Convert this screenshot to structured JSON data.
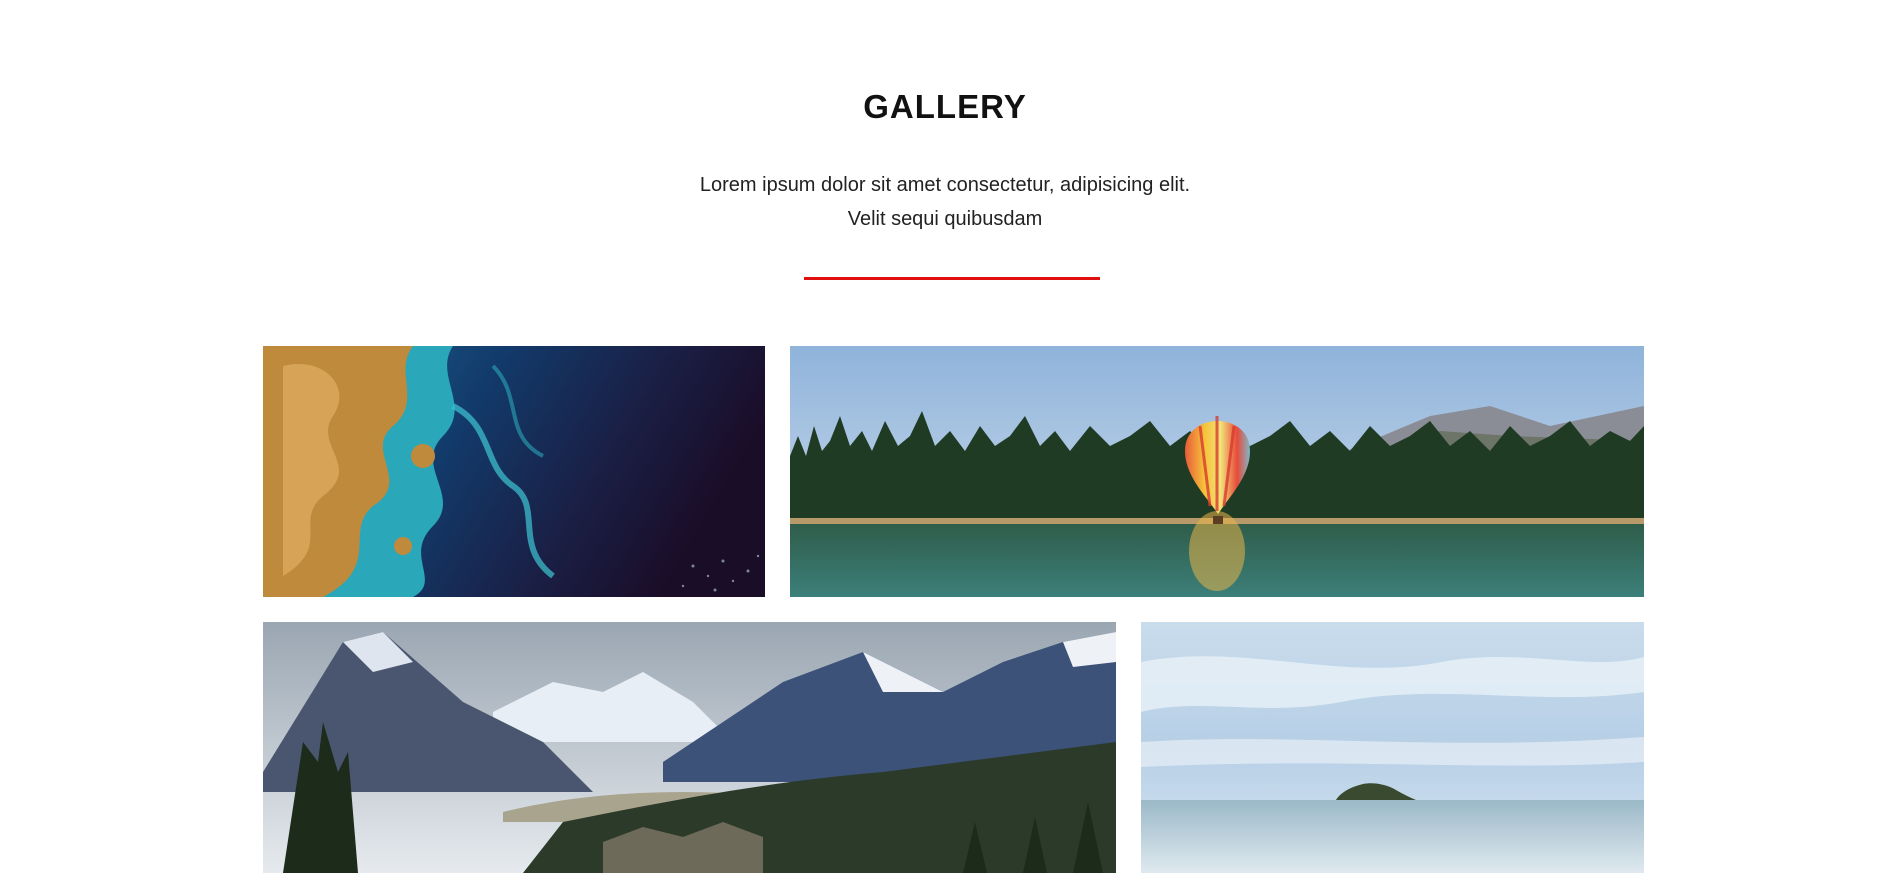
{
  "header": {
    "title": "GALLERY",
    "subtitle_line1": "Lorem ipsum dolor sit amet consectetur, adipisicing elit.",
    "subtitle_line2": "Velit sequi quibusdam"
  },
  "colors": {
    "accent": "#e01010",
    "background": "#ffffff",
    "text": "#111111"
  },
  "gallery": {
    "items": [
      {
        "subject": "satellite view of coastline and ocean"
      },
      {
        "subject": "hot air balloon over lake with pine forest and mountains"
      },
      {
        "subject": "snow-capped mountain valley with pine trees"
      },
      {
        "subject": "small island on calm sea under cloudy sky"
      }
    ]
  }
}
